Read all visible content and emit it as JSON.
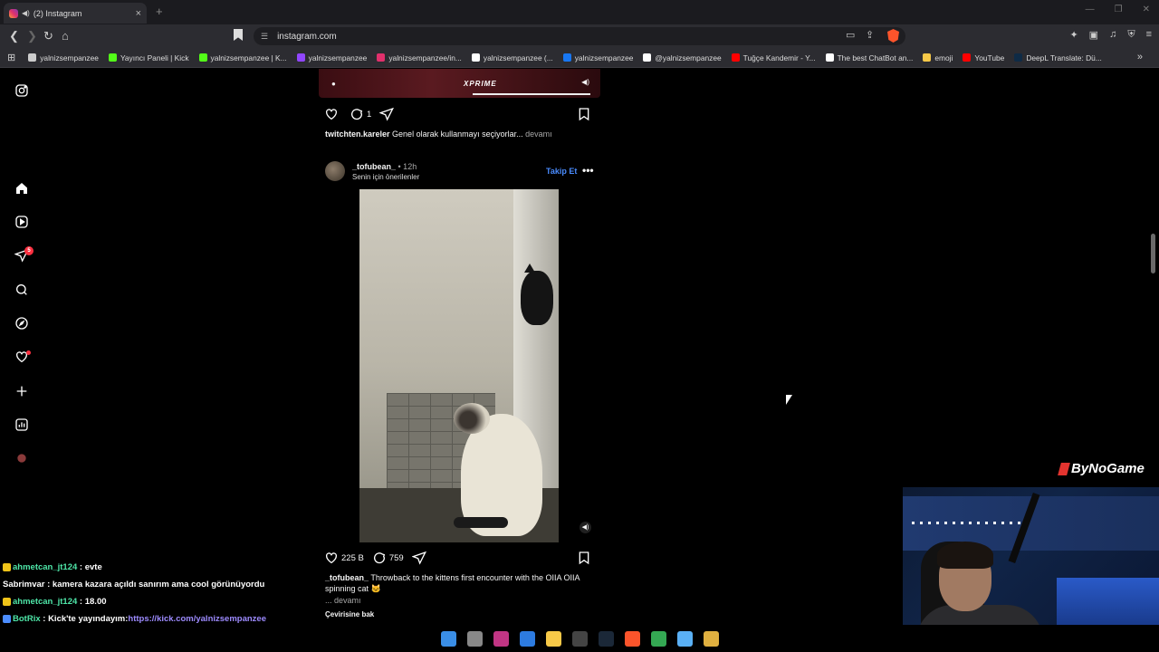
{
  "browser": {
    "tab_title": "(2) Instagram",
    "tab_speaker": "◀)",
    "tab_close": "×",
    "new_tab": "+",
    "url": "instagram.com",
    "bookmarks": [
      {
        "label": "yalnizsempanzee",
        "color": "#cccccc"
      },
      {
        "label": "Yayıncı Paneli | Kick",
        "color": "#53fc18"
      },
      {
        "label": "yalnizsempanzee | K...",
        "color": "#53fc18"
      },
      {
        "label": "yalnizsempanzee",
        "color": "#9146ff"
      },
      {
        "label": "yalnizsempanzee/in...",
        "color": "#e1306c"
      },
      {
        "label": "yalnizsempanzee (...",
        "color": "#ffffff"
      },
      {
        "label": "yalnizsempanzee",
        "color": "#1877f2"
      },
      {
        "label": "@yalnizsempanzee",
        "color": "#ffffff"
      },
      {
        "label": "Tuğçe Kandemir - Y...",
        "color": "#ff0000"
      },
      {
        "label": "The best ChatBot an...",
        "color": "#ffffff"
      },
      {
        "label": "emoji",
        "color": "#f7c948"
      },
      {
        "label": "YouTube",
        "color": "#ff0000"
      },
      {
        "label": "DeepL Translate: Dü...",
        "color": "#0f2b46"
      }
    ],
    "bookmarks_more": "»"
  },
  "sidebar": {
    "notification_badge": "5"
  },
  "post1": {
    "media_logo": "XPRIME",
    "comment_count": "1",
    "caption_user": "twitchten.kareler",
    "caption_text": "Genel olarak kullanmayı seçiyorlar...",
    "caption_more": "devamı"
  },
  "post2": {
    "username": "_tofubean_",
    "time": "• 12h",
    "suggestion": "Senin için önerilenler",
    "follow_label": "Takip Et",
    "more_label": "•••",
    "speaker": "◀)",
    "likes": "225 B",
    "comments": "759",
    "caption_user": "_tofubean_",
    "caption_text": "Throwback to the kittens first encounter with the OIIA OIIA spinning cat 🐱",
    "caption_more": "... devamı",
    "translate": "Çevirisine bak"
  },
  "overlay": {
    "brand": "ByNoGame",
    "chat": [
      {
        "user": "ahmetcan_jt124",
        "user_color": "#4ee6a8",
        "badge": "#f0c419",
        "text": ": evte"
      },
      {
        "user": "Sabrimvar",
        "user_color": "#ffffff",
        "badge": "",
        "text": ": kamera kazara açıldı sanırım ama cool görünüyordu"
      },
      {
        "user": "ahmetcan_jt124",
        "user_color": "#4ee6a8",
        "badge": "#f0c419",
        "text": ": 18.00"
      },
      {
        "user": "BotRix",
        "user_color": "#4ee6a8",
        "badge": "#4c8dff",
        "text": ": Kick'te yayındayım: ",
        "link": "https://kick.com/yalnizsempanzee"
      }
    ]
  },
  "taskbar": {
    "apps": [
      {
        "name": "windows-start",
        "color": "#3a8ee6"
      },
      {
        "name": "task-view",
        "color": "#888888"
      },
      {
        "name": "snipping",
        "color": "#c13584"
      },
      {
        "name": "photos",
        "color": "#2d7be0"
      },
      {
        "name": "file-explorer",
        "color": "#f7c948"
      },
      {
        "name": "obs",
        "color": "#444444"
      },
      {
        "name": "steam",
        "color": "#1b2838"
      },
      {
        "name": "brave",
        "color": "#fb542b"
      },
      {
        "name": "chrome",
        "color": "#34a853"
      },
      {
        "name": "notepad",
        "color": "#5ab0f5"
      },
      {
        "name": "app",
        "color": "#e0b040"
      }
    ]
  }
}
